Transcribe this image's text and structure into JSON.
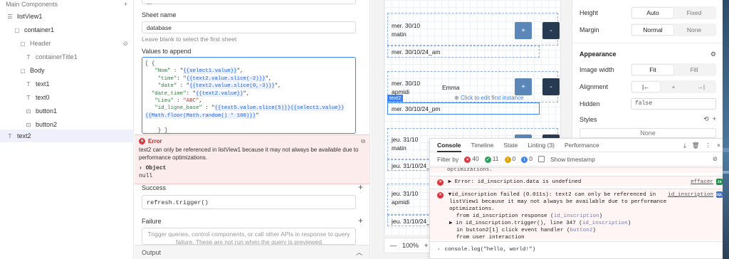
{
  "left_panel": {
    "header": "Main Components",
    "add_symbol": "+",
    "tree": [
      {
        "label": "listView1",
        "icon": "list-icon"
      },
      {
        "label": "container1",
        "icon": "container-icon"
      },
      {
        "label": "Header",
        "icon": "container-icon"
      },
      {
        "label": "containerTitle1",
        "icon": "text-icon"
      },
      {
        "label": "Body",
        "icon": "container-icon"
      },
      {
        "label": "text1",
        "icon": "text-icon"
      },
      {
        "label": "text0",
        "icon": "text-icon"
      },
      {
        "label": "button1",
        "icon": "button-icon"
      },
      {
        "label": "button2",
        "icon": "button-icon"
      },
      {
        "label": "text2",
        "icon": "text-icon"
      }
    ]
  },
  "query_panel": {
    "top_field_value": "...",
    "sheet_name_label": "Sheet name",
    "sheet_name_value": "database",
    "sheet_hint": "Leave blank to select the first sheet",
    "values_label": "Values to append",
    "error": {
      "title": "Error",
      "message": "text2 can only be referenced in listView1 because it may not always be available due to performance optimizations.",
      "object_label": "Object",
      "object_value": "null"
    },
    "success_label": "Success",
    "success_value": "refresh.trigger()",
    "failure_label": "Failure",
    "failure_placeholder": "Trigger queries, control components, or call other APIs in response to query failure. These are not run when the query is previewed",
    "output_label": "Output"
  },
  "canvas": {
    "rows": [
      {
        "date": "mer. 30/10",
        "slot": "matin",
        "name": ""
      },
      {
        "date": "mer. 30/10",
        "slot": "apmidi",
        "name": "Emma"
      },
      {
        "date": "jeu. 31/10",
        "slot": "matin",
        "name": ""
      },
      {
        "date": "jeu. 31/10",
        "slot": "apmidi",
        "name": ""
      }
    ],
    "captions": [
      "mer. 30/10/24_am",
      "mer. 30/10/24_pm",
      "jeu. 31/10/24_am",
      "jeu. 31/10/24_pm"
    ],
    "plus_label": "+",
    "minus_label": "-",
    "selected_tag": "text2",
    "edit_hint": "Click to edit first instance",
    "zoom": "100%"
  },
  "console": {
    "tabs": [
      "Console",
      "Timeline",
      "State",
      "Linting (3)",
      "Performance"
    ],
    "filter_label": "Filter by",
    "counts": {
      "errors": "40",
      "success": "11",
      "warnings": "0",
      "info": "0"
    },
    "timestamp_label": "Show timestamp",
    "logs": {
      "truncated": "optimizations.",
      "error1": "Error: id_inscription.data is undefined",
      "error1_src": "effacer",
      "error2_line1": "id_inscription failed (0.011s): text2 can only be referenced in",
      "error2_line2": "listView1 because it may not always be available due to performance",
      "error2_line3": "optimizations.",
      "error2_line4_a": "from id_inscription response (",
      "error2_line4_link": "id_inscription",
      "error2_line5_a": "in id_inscription.trigger(), line 347 (",
      "error2_line5_link": "id_inscription",
      "error2_line6_a": "in button2[1] click event handler (",
      "error2_line6_link": "button2",
      "error2_line7": "from user interaction",
      "error2_src": "id_inscription"
    },
    "input_value": "console.log(\"hello, world!\")"
  },
  "inspector": {
    "height_label": "Height",
    "height_options": [
      "Auto",
      "Fixed"
    ],
    "margin_label": "Margin",
    "margin_options": [
      "Normal",
      "None"
    ],
    "appearance_label": "Appearance",
    "image_width_label": "Image width",
    "image_width_options": [
      "Fit",
      "Fill"
    ],
    "alignment_label": "Alignment",
    "hidden_label": "Hidden",
    "hidden_value": "false",
    "styles_label": "Styles",
    "styles_value": "None"
  }
}
